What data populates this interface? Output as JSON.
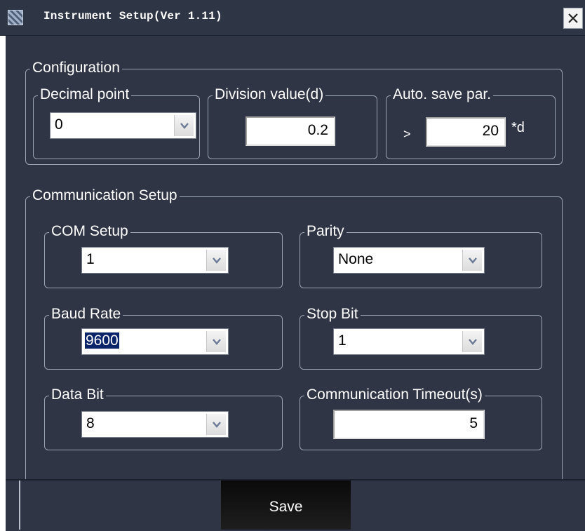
{
  "window": {
    "title": "Instrument Setup(Ver 1.11)",
    "close_glyph": "X"
  },
  "configuration": {
    "legend": "Configuration",
    "decimal_point": {
      "legend": "Decimal point",
      "value": "0"
    },
    "division_value": {
      "legend": "Division value(d)",
      "value": "0.2"
    },
    "auto_save": {
      "legend": "Auto. save par.",
      "prefix": ">",
      "value": "20",
      "suffix": "*d"
    }
  },
  "communication": {
    "legend": "Communication Setup",
    "com_setup": {
      "legend": "COM Setup",
      "value": "1"
    },
    "parity": {
      "legend": "Parity",
      "value": "None"
    },
    "baud_rate": {
      "legend": "Baud Rate",
      "value": "9600"
    },
    "stop_bit": {
      "legend": "Stop Bit",
      "value": "1"
    },
    "data_bit": {
      "legend": "Data Bit",
      "value": "8"
    },
    "timeout": {
      "legend": "Communication Timeout(s)",
      "value": "5"
    }
  },
  "footer": {
    "save_label": "Save"
  },
  "colors": {
    "panel_bg": "#2f3545",
    "group_border": "#9aa3b2",
    "selection": "#0a246a",
    "button_bg": "#111111"
  },
  "icons": [
    "app-icon",
    "close-icon",
    "chevron-down-icon"
  ]
}
